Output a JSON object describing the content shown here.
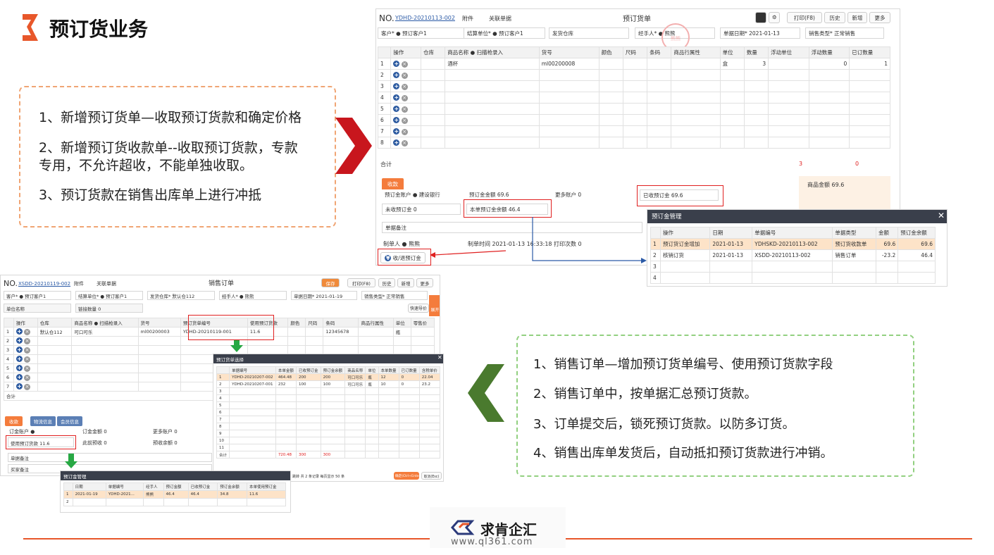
{
  "title": "预订货业务",
  "top_notes": [
    "1、新增预订货单—收取预订货款和确定价格",
    "2、新增预订货收款单--收取预订货款，专款",
    "专用，不允许超收，不能单独收取。",
    "3、预订货款在销售出库单上进行冲抵"
  ],
  "bottom_notes": [
    "1、销售订单—增加预订货单编号、使用预订货款字段",
    "2、销售订单中，按单据汇总预订货款。",
    "3、订单提交后，锁死预订货款。以防多订货。",
    "4、销售出库单发货后，自动抵扣预订货款进行冲销。"
  ],
  "brand": {
    "name": "求肯企汇",
    "url": "www.ql361.com"
  },
  "colors": {
    "accent": "#e8572a",
    "orange_dash": "#f0a574",
    "green_dash": "#92d080",
    "red_chevron": "#c8161d",
    "green_chevron": "#4a7a2e"
  },
  "preorder": {
    "no_label": "NO.",
    "no_value": "YDHD-20210113-002",
    "attach": "附件",
    "related": "关联单据",
    "window_title": "预订货单",
    "toolbar": [
      "打印(F8)",
      "历史",
      "新增",
      "更多"
    ],
    "fields": {
      "customer": "客户* ● 预订客户1",
      "settle": "结算单位* ● 预订客户1",
      "warehouse": "发货仓库",
      "handler": "经手人* ● 熊熊",
      "date": "单据日期* 2021-01-13",
      "sale_type": "销售类型* 正常销售"
    },
    "columns": [
      "",
      "操作",
      "仓库",
      "商品名称 ● 扫描枪录入",
      "货号",
      "颜色",
      "尺码",
      "条码",
      "商品行属性",
      "单位",
      "数量",
      "浮动单位",
      "浮动数量",
      "已订数量"
    ],
    "rows": [
      {
        "n": "1",
        "name": "酒杯",
        "code": "ml00200008",
        "unit": "盒",
        "qty": "3",
        "fqty": "0",
        "ordered": "1"
      },
      {
        "n": "2"
      },
      {
        "n": "3"
      },
      {
        "n": "4"
      },
      {
        "n": "5"
      },
      {
        "n": "6"
      },
      {
        "n": "7"
      },
      {
        "n": "8"
      }
    ],
    "total_label": "合计",
    "total_qty": "3",
    "total_fqty": "0",
    "pay_tab": "收款",
    "pay_account": "预订金账户 ● 建设银行",
    "pay_total": "预订金金额 69.6",
    "more_account": "更多账户 0",
    "received": "已收预订金 69.6",
    "goods_amount": "商品金额 69.6",
    "unreceived": "未收预订金 0",
    "balance": "本单预订金余额 46.4",
    "memo": "单据备注",
    "maker": "制单人 ● 熊熊",
    "make_time": "制单时间 2021-01-13 16:33:18",
    "print_count": "打印次数 0",
    "refund_btn": "收/退预订金",
    "stamp": "熊熊"
  },
  "mgmt1": {
    "title": "预订金管理",
    "columns": [
      "",
      "操作",
      "日期",
      "单据编号",
      "单据类型",
      "金额",
      "预订金余额"
    ],
    "rows": [
      [
        "1",
        "预订货订金增加",
        "2021-01-13",
        "YDHSKD-20210113-002",
        "预订货收款单",
        "69.6",
        "69.6"
      ],
      [
        "2",
        "核销订货",
        "2021-01-13",
        "XSDD-20210113-002",
        "销售订单",
        "-23.2",
        "46.4"
      ],
      [
        "3",
        "",
        "",
        "",
        "",
        "",
        ""
      ],
      [
        "4",
        "",
        "",
        "",
        "",
        "",
        ""
      ]
    ]
  },
  "sales": {
    "no_label": "NO.",
    "no_value": "XSDD-20210119-002",
    "attach": "附件",
    "related": "关联单据",
    "window_title": "销售订单",
    "save": "保存",
    "toolbar": [
      "打印(F8)",
      "历史",
      "新增",
      "更多"
    ],
    "fields": {
      "customer": "客户* ● 预订客户1",
      "settle": "结算单位* ● 预订客户1",
      "warehouse": "发货仓库* 默认仓112",
      "handler": "经手人* ● 熊熊",
      "date": "单据日期* 2021-01-19",
      "sale_type": "销售类型* 正常销售",
      "unit_name": "单位名称",
      "link_qty": "链接数量 0",
      "quick": "快速导价"
    },
    "columns": [
      "",
      "操作",
      "仓库",
      "商品名称 ● 扫描枪录入",
      "货号",
      "预订货单编号",
      "使用预订货款",
      "颜色",
      "尺码",
      "条码",
      "商品行属性",
      "单位",
      "零售价"
    ],
    "rows": [
      {
        "n": "1",
        "wh": "默认仓112",
        "name": "可口可乐",
        "code": "ml00200003",
        "pre": "YDHD-20210119-001",
        "use": "11.6",
        "barcode": "12345678",
        "unit": "瓶"
      },
      {
        "n": "2"
      },
      {
        "n": "3"
      },
      {
        "n": "4"
      },
      {
        "n": "5"
      },
      {
        "n": "6"
      },
      {
        "n": "7"
      }
    ],
    "total_label": "合计",
    "tabs": [
      "收款",
      "物流信息",
      "会员信息"
    ],
    "pay_account": "订金账户 ●",
    "order_amount": "订金金额 0",
    "more_account": "更多账户 0",
    "use_deposit": "使用预订货款 11.6",
    "this_receive": "此前预收 0",
    "pre_balance": "预收余额 0",
    "memo": "单据备注",
    "buyer_memo": "买家备注",
    "side_btn": "展开"
  },
  "picker": {
    "title": "预订货单选择",
    "columns": [
      "",
      "单据编号",
      "本单金额",
      "已收预订金",
      "预订金余额",
      "商品名称",
      "单位",
      "本单数量",
      "已订数量",
      "含税单价"
    ],
    "rows": [
      [
        "1",
        "YDHD-20210207-002",
        "464.48",
        "200",
        "200",
        "可口可乐",
        "瓶",
        "12",
        "0",
        "22.04"
      ],
      [
        "2",
        "YDHD-20210207-001",
        "232",
        "100",
        "100",
        "可口可乐",
        "瓶",
        "10",
        "0",
        "23.2"
      ]
    ],
    "empty_rows": [
      "3",
      "4",
      "5",
      "6",
      "7",
      "8",
      "9",
      "10",
      "11"
    ],
    "total": [
      "合计",
      "",
      "720.48",
      "300",
      "300",
      "",
      "",
      "",
      "",
      ""
    ],
    "pager": "首页 ◀ 上页 第 1/1 页 下页 ▶ 尾页  跳转到 1 页 跳转  共 2 条记录 每页显示 50 条",
    "confirm": "确定(Ctrl+Enter)",
    "cancel": "取消(Esc)"
  },
  "mgmt2": {
    "title": "预订金管理",
    "columns": [
      "",
      "日期",
      "单据编号",
      "经手人",
      "预订金额",
      "已收预订金",
      "预订金余额",
      "本单使用预订金"
    ],
    "rows": [
      [
        "1",
        "2021-01-19",
        "YDHD-2021...",
        "熊熊",
        "46.4",
        "46.4",
        "34.8",
        "11.6"
      ],
      [
        "2",
        "",
        "",
        "",
        "",
        "",
        "",
        ""
      ]
    ]
  }
}
